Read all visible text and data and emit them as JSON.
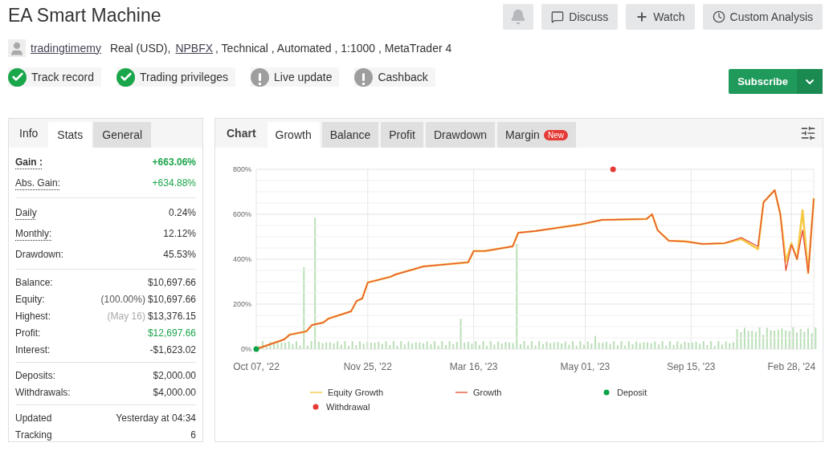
{
  "title": "EA Smart Machine",
  "account": {
    "author": "tradingtimemy",
    "type": "Real (USD),",
    "broker": "NPBFX",
    "details": ", Technical , Automated , 1:1000 , MetaTrader 4"
  },
  "badges": [
    {
      "label": "Track record",
      "verified": true
    },
    {
      "label": "Trading privileges",
      "verified": true
    },
    {
      "label": "Live update",
      "verified": false
    },
    {
      "label": "Cashback",
      "verified": false
    }
  ],
  "actions": [
    {
      "kind": "bell"
    },
    {
      "kind": "discuss",
      "label": "Discuss"
    },
    {
      "kind": "watch",
      "label": "Watch"
    },
    {
      "kind": "analysis",
      "label": "Custom Analysis"
    }
  ],
  "subscribe": {
    "label": "Subscribe"
  },
  "stats_panel": {
    "heading": "Info",
    "tabs": [
      {
        "label": "Stats",
        "selected": true
      },
      {
        "label": "General",
        "selected": false
      }
    ],
    "groups": [
      [
        {
          "label": "Gain :",
          "value": "+663.06%",
          "bold": true,
          "underlined": true,
          "positive": true
        },
        {
          "label": "Abs. Gain:",
          "value": "+634.88%",
          "bold": false,
          "underlined": true,
          "positive": true
        }
      ],
      [
        {
          "label": "Daily",
          "value": "0.24%",
          "bold": false,
          "underlined": true,
          "positive": false
        },
        {
          "label": "Monthly:",
          "value": "12.12%",
          "bold": false,
          "underlined": true,
          "positive": false
        },
        {
          "label": "Drawdown:",
          "value": "45.53%",
          "bold": false,
          "underlined": false,
          "positive": false
        }
      ],
      [
        {
          "label": "Balance:",
          "value": "$10,697.66",
          "bold": false,
          "underlined": false,
          "positive": false
        },
        {
          "label": "Equity:",
          "note": "(100.00%)",
          "note_faint": false,
          "value": "$10,697.66",
          "bold": false,
          "underlined": false,
          "positive": false
        },
        {
          "label": "Highest:",
          "note": "(May 16)",
          "note_faint": true,
          "value": "$13,376.15",
          "bold": false,
          "underlined": false,
          "positive": false
        },
        {
          "label": "Profit:",
          "value": "$12,697.66",
          "bold": false,
          "underlined": false,
          "positive": true
        },
        {
          "label": "Interest:",
          "value": "-$1,623.02",
          "bold": false,
          "underlined": false,
          "positive": false
        }
      ],
      [
        {
          "label": "Deposits:",
          "value": "$2,000.00",
          "bold": false,
          "underlined": false,
          "positive": false
        },
        {
          "label": "Withdrawals:",
          "value": "$4,000.00",
          "bold": false,
          "underlined": false,
          "positive": false
        }
      ],
      [
        {
          "label": "Updated",
          "value": "Yesterday at 04:34",
          "bold": false,
          "underlined": false,
          "positive": false
        },
        {
          "label": "Tracking",
          "value": "6",
          "bold": false,
          "underlined": false,
          "positive": false
        }
      ]
    ]
  },
  "chart_panel": {
    "heading": "Chart",
    "tabs": [
      {
        "label": "Growth",
        "selected": true
      },
      {
        "label": "Balance",
        "selected": false
      },
      {
        "label": "Profit",
        "selected": false
      },
      {
        "label": "Drawdown",
        "selected": false
      },
      {
        "label": "Margin",
        "selected": false,
        "badge": "New"
      }
    ],
    "chart_data": {
      "type": "line",
      "grid": true,
      "legend": true,
      "ylim": [
        0,
        800
      ],
      "yticks": [
        {
          "value": 0,
          "label": "0%"
        },
        {
          "value": 200,
          "label": "200%"
        },
        {
          "value": 400,
          "label": "400%"
        },
        {
          "value": 600,
          "label": "600%"
        },
        {
          "value": 800,
          "label": "800%"
        }
      ],
      "categories": [
        "Oct 07, '22",
        null,
        null,
        null,
        null,
        null,
        null,
        null,
        null,
        null,
        null,
        null,
        null,
        null,
        null,
        null,
        null,
        null,
        null,
        null,
        "Nov 25, '22",
        null,
        null,
        null,
        null,
        null,
        null,
        null,
        null,
        null,
        null,
        null,
        null,
        null,
        null,
        null,
        null,
        null,
        null,
        "Mar 16, '23",
        null,
        null,
        null,
        null,
        null,
        null,
        null,
        null,
        null,
        null,
        null,
        null,
        null,
        null,
        null,
        null,
        null,
        null,
        null,
        "May 01, '23",
        null,
        null,
        null,
        null,
        null,
        null,
        null,
        null,
        null,
        null,
        null,
        null,
        null,
        null,
        null,
        null,
        null,
        null,
        "Sep 15, '23",
        null,
        null,
        null,
        null,
        null,
        null,
        null,
        null,
        null,
        null,
        null,
        null,
        null,
        null,
        null,
        null,
        null,
        "Feb 28, '24",
        null,
        null,
        null,
        null
      ],
      "series": [
        {
          "name": "Equity Growth",
          "color": "#f5c842",
          "values": [
            0,
            null,
            null,
            null,
            null,
            43,
            64,
            null,
            null,
            79,
            107,
            null,
            118,
            136,
            null,
            null,
            null,
            168,
            214,
            225,
            296,
            null,
            null,
            null,
            321,
            332,
            null,
            null,
            null,
            null,
            368,
            null,
            null,
            null,
            null,
            null,
            null,
            null,
            386,
            436,
            null,
            436,
            null,
            null,
            null,
            null,
            457,
            518,
            null,
            null,
            525,
            null,
            null,
            null,
            null,
            null,
            null,
            null,
            554,
            null,
            null,
            null,
            575,
            null,
            576,
            null,
            null,
            null,
            null,
            null,
            579,
            600,
            529,
            null,
            482,
            null,
            null,
            479,
            null,
            null,
            468,
            null,
            null,
            null,
            471,
            null,
            null,
            490,
            null,
            null,
            445,
            654,
            null,
            707,
            600,
            390,
            470,
            400,
            618,
            339,
            668
          ]
        },
        {
          "name": "Growth",
          "color": "#e8553a",
          "values": [
            0,
            null,
            null,
            null,
            null,
            43,
            64,
            null,
            null,
            79,
            107,
            null,
            118,
            136,
            null,
            null,
            null,
            168,
            214,
            225,
            296,
            null,
            null,
            null,
            321,
            332,
            null,
            null,
            null,
            null,
            368,
            null,
            null,
            null,
            null,
            null,
            null,
            null,
            386,
            436,
            null,
            436,
            null,
            null,
            null,
            null,
            457,
            518,
            null,
            null,
            525,
            null,
            null,
            null,
            null,
            null,
            null,
            null,
            554,
            null,
            null,
            null,
            575,
            null,
            576,
            null,
            null,
            null,
            null,
            null,
            579,
            600,
            529,
            null,
            482,
            null,
            null,
            479,
            null,
            null,
            468,
            null,
            null,
            null,
            471,
            null,
            null,
            496,
            null,
            null,
            457,
            654,
            null,
            707,
            600,
            350,
            464,
            400,
            529,
            339,
            668
          ]
        },
        {
          "name": "Deposit",
          "color": "#0aa34a",
          "marker": "circle",
          "values": [
            0,
            null,
            null,
            null,
            null,
            null,
            null,
            null,
            null,
            null,
            null,
            null,
            null,
            null,
            null,
            null,
            null,
            null,
            null,
            null,
            null,
            null,
            null,
            null,
            null,
            null,
            null,
            null,
            null,
            null,
            null,
            null,
            null,
            null,
            null,
            null,
            null,
            null,
            null,
            null,
            null,
            null,
            null,
            null,
            null,
            null,
            null,
            null,
            null,
            null,
            null,
            null,
            null,
            null,
            null,
            null,
            null,
            null,
            null,
            null,
            null,
            null,
            null,
            null,
            null,
            null,
            null,
            null,
            null,
            null,
            null,
            null,
            null,
            null,
            null,
            null,
            null,
            null,
            null,
            null,
            null,
            null,
            null,
            null,
            null,
            null,
            null,
            null,
            null,
            null,
            null,
            null,
            null,
            null,
            null,
            null,
            null,
            null,
            null,
            null,
            null
          ]
        },
        {
          "name": "Withdrawal",
          "color": "#e53935",
          "marker": "circle",
          "values": [
            null,
            null,
            null,
            null,
            null,
            null,
            null,
            null,
            null,
            null,
            null,
            null,
            null,
            null,
            null,
            null,
            null,
            null,
            null,
            null,
            null,
            null,
            null,
            null,
            null,
            null,
            null,
            null,
            null,
            null,
            null,
            null,
            null,
            null,
            null,
            null,
            null,
            null,
            null,
            null,
            null,
            null,
            null,
            null,
            null,
            null,
            null,
            null,
            null,
            null,
            null,
            null,
            null,
            null,
            null,
            null,
            null,
            null,
            null,
            null,
            null,
            null,
            null,
            null,
            800,
            null,
            null,
            null,
            null,
            null,
            null,
            null,
            null,
            null,
            null,
            null,
            null,
            null,
            null,
            null,
            null,
            null,
            null,
            null,
            null,
            null,
            null,
            null,
            null,
            null,
            null,
            null,
            null,
            null,
            null,
            null,
            null,
            null,
            null,
            null,
            null
          ]
        }
      ]
    }
  }
}
